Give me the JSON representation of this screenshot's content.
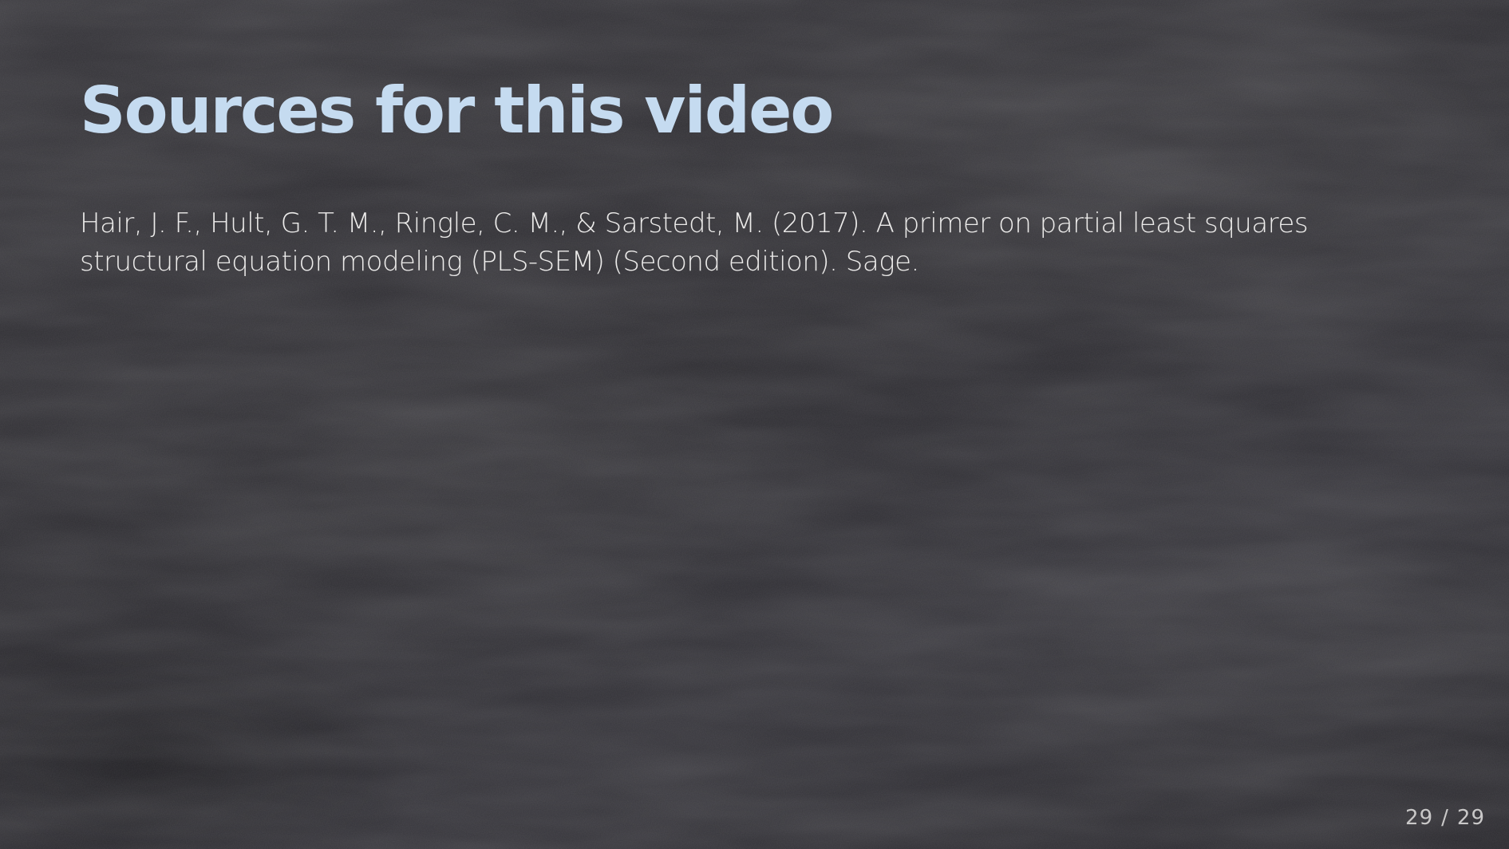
{
  "slide": {
    "title": "Sources for this video",
    "reference": "Hair, J. F., Hult, G. T. M., Ringle, C. M., & Sarstedt, M. (2017). A primer on partial least squares structural equation modeling (PLS-SEM) (Second edition). Sage.",
    "page": {
      "current": "29",
      "separator": "/",
      "total": "29"
    }
  },
  "colors": {
    "background": "#2e2d32",
    "title": "#c5dbf0",
    "body_text": "#ecebea",
    "page_number": "#c9c8c8"
  }
}
